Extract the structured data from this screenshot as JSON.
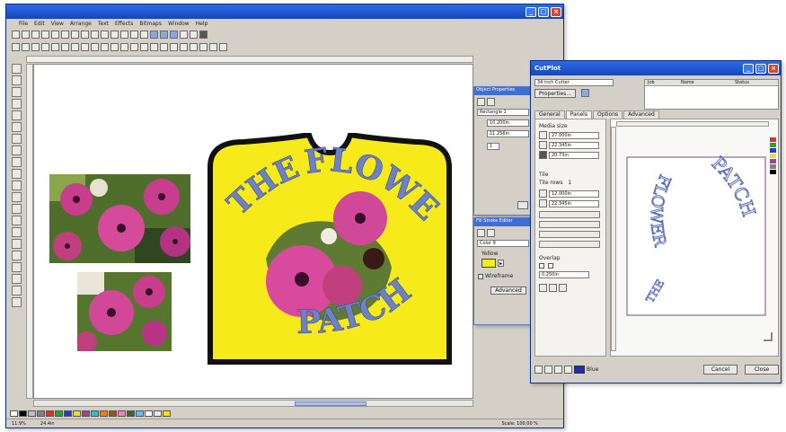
{
  "main_window": {
    "title": "",
    "menu": [
      "File",
      "Edit",
      "View",
      "Arrange",
      "Text",
      "Effects",
      "Bitmaps",
      "Window",
      "Help"
    ],
    "status": {
      "left_a": "11.9%",
      "left_b": "24.4in",
      "right": "Scale: 100.00 %"
    },
    "palette": [
      "#ffffff",
      "#000000",
      "#c0c0c0",
      "#808080",
      "#e03030",
      "#30a030",
      "#2040c0",
      "#e8e030",
      "#a040a0",
      "#30c0c0",
      "#f08020",
      "#8a5a20",
      "#ff80c0",
      "#406040",
      "#60c0ff",
      "#ffffff",
      "#e8e8e8",
      "#ffe000"
    ]
  },
  "sign": {
    "line1": "THE",
    "line2": "FLOWER",
    "line3": "PATCH",
    "bg_color": "#f6ea1a",
    "text_color": "#6d82c6"
  },
  "properties_panel": {
    "title": "Object Properties",
    "fields": [
      "Rectangle 1",
      "10.200in",
      "11.256in"
    ],
    "num": "1"
  },
  "color_panel": {
    "title": "Fill Stroke Editor",
    "field": "Color 9",
    "label": "Yellow",
    "checkbox": "Wireframe",
    "button": "Advanced"
  },
  "cutplot": {
    "title": "CutPlot",
    "device": "34 inch Cutter",
    "properties_btn": "Properties...",
    "col_headers": [
      "Job",
      "Name",
      "Status"
    ],
    "tabs": [
      "General",
      "Panels",
      "Options",
      "Advanced"
    ],
    "media_size_label": "Media size",
    "media_fields": [
      "27.000in",
      "22.345in",
      "20.73in"
    ],
    "tile_label": "Tile",
    "tile_label2": "Tile rows",
    "tile_value": "1",
    "tile_fields": [
      "12.000in",
      "22.345in"
    ],
    "overlap_label": "Overlap",
    "overlap_field": "0.250in",
    "preview_text_outer": "PATCH",
    "preview_text_inner": "FLOWER",
    "preview_text_small": "THE",
    "color_name": "Blue",
    "cancel_btn": "Cancel",
    "close_btn": "Close"
  }
}
